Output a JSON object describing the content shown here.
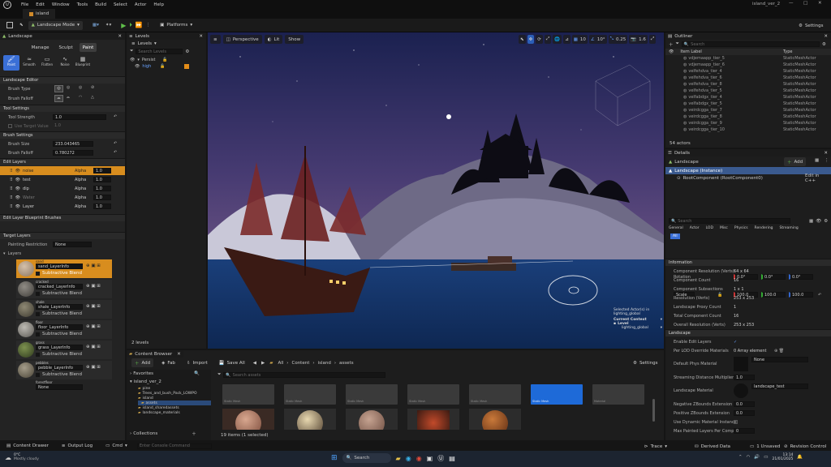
{
  "app_menu": [
    "File",
    "Edit",
    "Window",
    "Tools",
    "Build",
    "Select",
    "Actor",
    "Help"
  ],
  "project_name": "island_ver_2",
  "level_tab": "island",
  "toolbar": {
    "mode": "Landscape Mode",
    "platforms": "Platforms",
    "settings": "Settings"
  },
  "landscape_panel": {
    "tab": "Landscape",
    "mode_tabs": [
      "Manage",
      "Sculpt",
      "Paint"
    ],
    "tools": [
      "Paint",
      "Smooth",
      "Flatten",
      "Noise",
      "Blueprint"
    ],
    "sections": {
      "editor": "Landscape Editor",
      "tool_settings": "Tool Settings",
      "brush_settings": "Brush Settings",
      "edit_layers": "Edit Layers",
      "blueprint_brushes": "Edit Layer Blueprint Brushes",
      "target_layers": "Target Layers"
    },
    "brush_type_label": "Brush Type",
    "brush_falloff_label": "Brush Falloff",
    "tool_strength_label": "Tool Strength",
    "tool_strength": "1.0",
    "use_target_value_label": "Use Target Value",
    "target_value": "1.0",
    "brush_size_label": "Brush Size",
    "brush_size": "233.043465",
    "brush_falloff_value_label": "Brush Falloff",
    "brush_falloff_value": "0.780272",
    "edit_layers": [
      {
        "name": "noise",
        "alpha_label": "Alpha",
        "alpha": "1.0",
        "active": true
      },
      {
        "name": "test",
        "alpha_label": "Alpha",
        "alpha": "1.0",
        "active": false
      },
      {
        "name": "dip",
        "alpha_label": "Alpha",
        "alpha": "1.0",
        "active": false
      },
      {
        "name": "Water",
        "alpha_label": "Alpha",
        "alpha": "1.0",
        "active": false
      },
      {
        "name": "Layer",
        "alpha_label": "Alpha",
        "alpha": "1.0",
        "active": false
      }
    ],
    "painting_restriction_label": "Painting Restriction",
    "painting_restriction": "None",
    "layers_label": "Layers",
    "layers": [
      {
        "name": "sand",
        "info": "sand_LayerInfo",
        "blend": "Subtractive Blend",
        "color": "#b39a82"
      },
      {
        "name": "cracked",
        "info": "cracked_LayerInfo",
        "blend": "Subtractive Blend",
        "color": "#6d6a63"
      },
      {
        "name": "shale",
        "info": "shale_LayerInfo",
        "blend": "Subtractive Blend",
        "color": "#6c6656"
      },
      {
        "name": "floor",
        "info": "floor_LayerInfo",
        "blend": "Subtractive Blend",
        "color": "#8e8c86"
      },
      {
        "name": "grass",
        "info": "grass_LayerInfo",
        "blend": "Subtractive Blend",
        "color": "#596b3c"
      },
      {
        "name": "pebbles",
        "info": "pebble_LayerInfo",
        "blend": "Subtractive Blend",
        "color": "#7d7666"
      },
      {
        "name": "forestfloor",
        "info": "None",
        "blend": "",
        "color": ""
      }
    ]
  },
  "levels_panel": {
    "tab": "Levels",
    "dropdown": "Levels",
    "search_placeholder": "Search Levels",
    "items": [
      "Persist",
      "high"
    ],
    "footer": "2 levels"
  },
  "viewport": {
    "perspective": "Perspective",
    "lit": "Lit",
    "show": "Show",
    "grid_snap": "10",
    "angle_snap": "10°",
    "scale_snap": "0.25",
    "camera_speed": "1.6",
    "selected_text": "Selected Actor(s) in",
    "selected_level": "lighting_global",
    "current_context_label": "Current Context",
    "level_label": "Level",
    "level_value": "lighting_global"
  },
  "outliner": {
    "tab": "Outliner",
    "search_placeholder": "Search",
    "col_label": "Item Label",
    "col_type": "Type",
    "rows": [
      {
        "label": "vdjemaapp_tier_5",
        "type": "StaticMeshActor"
      },
      {
        "label": "vdjemaapp_tier_6",
        "type": "StaticMeshActor"
      },
      {
        "label": "velfehdva_tier_4",
        "type": "StaticMeshActor"
      },
      {
        "label": "velfehdva_tier_6",
        "type": "StaticMeshActor"
      },
      {
        "label": "velfehdva_tier_8",
        "type": "StaticMeshActor"
      },
      {
        "label": "velfehdva_tier_5",
        "type": "StaticMeshActor"
      },
      {
        "label": "velfabdgx_tier_4",
        "type": "StaticMeshActor"
      },
      {
        "label": "velfabdgx_tier_5",
        "type": "StaticMeshActor"
      },
      {
        "label": "veirdcgga_tier_7",
        "type": "StaticMeshActor"
      },
      {
        "label": "veirdcgga_tier_8",
        "type": "StaticMeshActor"
      },
      {
        "label": "veirdcgga_tier_9",
        "type": "StaticMeshActor"
      },
      {
        "label": "veirdcgga_tier_10",
        "type": "StaticMeshActor"
      }
    ],
    "footer": "54 actors"
  },
  "details": {
    "tab": "Details",
    "title": "Landscape",
    "add": "Add",
    "instance": "Landscape (Instance)",
    "component": "RootComponent (RootComponent0)",
    "edit_cpp": "Edit in C++",
    "search_placeholder": "Search",
    "categories": [
      "General",
      "Actor",
      "LOD",
      "Misc",
      "Physics",
      "Rendering",
      "Streaming",
      "All"
    ],
    "rotation_label": "Rotation",
    "rotation": [
      "0.0°",
      "0.0°",
      "0.0°"
    ],
    "scale_label": "Scale",
    "scale": [
      "100.0",
      "100.0",
      "100.0"
    ],
    "information_label": "Information",
    "info_rows": [
      {
        "label": "Component Resolution (Verts)",
        "value": "64 x 64"
      },
      {
        "label": "Component Count",
        "value": "16"
      },
      {
        "label": "Component Subsections",
        "value": "1 x 1"
      },
      {
        "label": "Resolution (Verts)",
        "value": "253 x 253"
      },
      {
        "label": "Landscape Proxy Count",
        "value": "1"
      },
      {
        "label": "Total Component Count",
        "value": "16"
      },
      {
        "label": "Overall Resolution (Verts)",
        "value": "253 x 253"
      }
    ],
    "landscape_label": "Landscape",
    "land_rows": [
      {
        "label": "Enable Edit Layers",
        "value": ""
      },
      {
        "label": "Per LOD Override Materials",
        "value": "0 Array element"
      },
      {
        "label": "Default Phys Material",
        "value": "None"
      },
      {
        "label": "Streaming Distance Multiplier",
        "value": "1.0"
      },
      {
        "label": "Landscape Material",
        "value": "landscape_test"
      },
      {
        "label": "Negative ZBounds Extension",
        "value": "0.0"
      },
      {
        "label": "Positive ZBounds Extension",
        "value": "0.0"
      },
      {
        "label": "Use Dynamic Material Instance",
        "value": ""
      },
      {
        "label": "Max Painted Layers Per Component",
        "value": "0"
      }
    ]
  },
  "content_browser": {
    "tab": "Content Browser",
    "add": "Add",
    "fab": "Fab",
    "import": "Import",
    "save_all": "Save All",
    "breadcrumb": [
      "All",
      "Content",
      "island",
      "assets"
    ],
    "settings": "Settings",
    "favorites": "Favorites",
    "root": "island_ver_2",
    "search_placeholder": "Search assets",
    "tree": [
      "pine",
      "Trees_and_bush_Pack_LOWPO",
      "island",
      "assets",
      "island_sharedassets",
      "landscape_materials"
    ],
    "collections": "Collections",
    "status": "19 items (1 selected)",
    "assets": [
      {
        "label": "Static Mesh",
        "selected": false
      },
      {
        "label": "Static Mesh",
        "selected": false
      },
      {
        "label": "Static Mesh",
        "selected": false
      },
      {
        "label": "Static Mesh",
        "selected": false
      },
      {
        "label": "Static Mesh",
        "selected": false
      },
      {
        "label": "Static Mesh",
        "selected": true
      },
      {
        "label": "Material",
        "selected": false
      }
    ]
  },
  "status_bar": {
    "content_drawer": "Content Drawer",
    "output_log": "Output Log",
    "cmd": "Cmd",
    "console_placeholder": "Enter Console Command",
    "trace": "Trace",
    "derived_data": "Derived Data",
    "unsaved": "1 Unsaved",
    "revision_control": "Revision Control"
  },
  "taskbar": {
    "temp": "0°C",
    "weather": "Mostly cloudy",
    "search": "Search",
    "time": "13:14",
    "date": "21/01/2025"
  }
}
